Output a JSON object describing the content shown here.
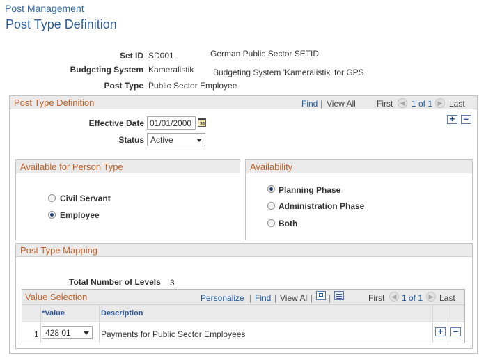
{
  "breadcrumb": "Post Management",
  "page_title": "Post Type Definition",
  "header_fields": {
    "setid_label": "Set ID",
    "setid_value": "SD001",
    "setid_desc": "German Public Sector SETID",
    "budgeting_label": "Budgeting System",
    "budgeting_value": "Kameralistik",
    "budgeting_desc": "Budgeting System 'Kameralistik' for GPS",
    "posttype_label": "Post Type",
    "posttype_value": "Public Sector Employee"
  },
  "definition": {
    "title": "Post Type Definition",
    "find": "Find",
    "sep": "|",
    "view_all": "View All",
    "first": "First",
    "count": "1 of 1",
    "last": "Last",
    "effective_date_label": "Effective Date",
    "effective_date_value": "01/01/2000",
    "status_label": "Status",
    "status_value": "Active"
  },
  "person_type": {
    "title": "Available for Person Type",
    "options": [
      "Civil Servant",
      "Employee"
    ],
    "selected": "Employee"
  },
  "availability": {
    "title": "Availability",
    "options": [
      "Planning Phase",
      "Administration Phase",
      "Both"
    ],
    "selected": "Planning Phase"
  },
  "mapping": {
    "title": "Post Type Mapping",
    "levels_label": "Total Number of Levels",
    "levels_value": "3"
  },
  "value_selection": {
    "title": "Value Selection",
    "personalize": "Personalize",
    "find": "Find",
    "view_all": "View All",
    "first": "First",
    "count": "1 of 1",
    "last": "Last",
    "col_value": "*Value",
    "col_description": "Description",
    "rows": [
      {
        "num": "1",
        "value": "428 01",
        "description": "Payments for Public Sector Employees"
      }
    ]
  },
  "colors": {
    "accent_title": "#2e5b9a",
    "section_title": "#c0632b",
    "link": "#1c5a9c",
    "header_bg": "#eaeaea"
  },
  "icons": [
    "calendar-icon",
    "prev-arrow-icon",
    "next-arrow-icon",
    "add-icon",
    "delete-icon",
    "zoom-icon",
    "download-icon"
  ]
}
